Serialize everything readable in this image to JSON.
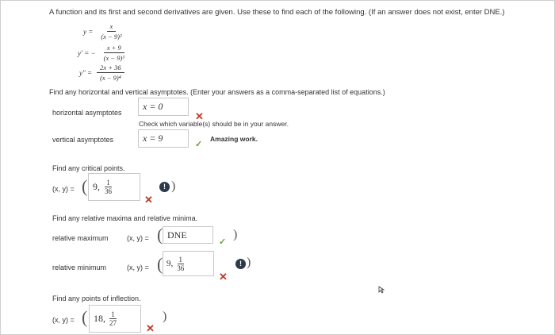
{
  "instructions": "A function and its first and second derivatives are given. Use these to find each of the following. (If an answer does not exist, enter DNE.)",
  "equations": {
    "y_lhs": "y =",
    "y_num": "x",
    "y_den": "(x − 9)²",
    "y1_lhs": "y′ = −",
    "y1_num": "x + 9",
    "y1_den": "(x − 9)³",
    "y2_lhs": "y″ =",
    "y2_num": "2x + 36",
    "y2_den": "(x − 9)⁴"
  },
  "asymptotes": {
    "prompt": "Find any horizontal and vertical asymptotes. (Enter your answers as a comma-separated list of equations.)",
    "horizontal_label": "horizontal asymptotes",
    "horizontal_value": "x = 0",
    "hint": "Check which variable(s) should be in your answer.",
    "vertical_label": "vertical asymptotes",
    "vertical_value": "x = 9",
    "feedback": "Amazing work."
  },
  "critical": {
    "prompt": "Find any critical points.",
    "label": "(x, y) =",
    "x": "9,",
    "num": "1",
    "den": "36"
  },
  "extrema": {
    "prompt": "Find any relative maxima and relative minima.",
    "max_label": "relative maximum",
    "max_xy": "(x, y) =",
    "max_value": "DNE",
    "min_label": "relative minimum",
    "min_xy": "(x, y) =",
    "min_x": "9,",
    "min_num": "1",
    "min_den": "36"
  },
  "inflection": {
    "prompt": "Find any points of inflection.",
    "label": "(x, y) =",
    "x": "18,",
    "num": "1",
    "den": "27"
  },
  "icons": {
    "incorrect": "✕",
    "correct": "✓",
    "alert": "!"
  },
  "colors": {
    "incorrect": "#c0392b",
    "correct": "#6aa03c",
    "alert": "#2d3a4b"
  }
}
